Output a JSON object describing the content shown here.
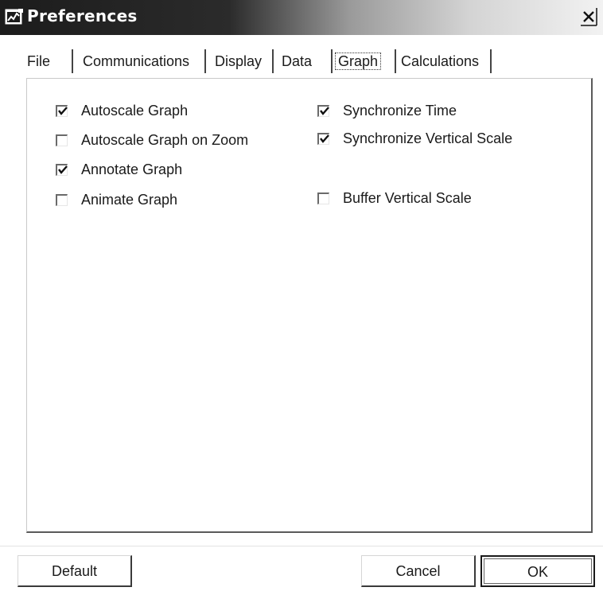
{
  "window": {
    "title": "Preferences",
    "close_glyph": "×",
    "title_icon": "chart-window-icon"
  },
  "tabs": [
    {
      "label": "File",
      "selected": false
    },
    {
      "label": "Communications",
      "selected": false
    },
    {
      "label": "Display",
      "selected": false
    },
    {
      "label": "Data",
      "selected": false
    },
    {
      "label": "Graph",
      "selected": true
    },
    {
      "label": "Calculations",
      "selected": false
    }
  ],
  "options_left": [
    {
      "label": "Autoscale Graph",
      "checked": true
    },
    {
      "label": "Autoscale Graph on Zoom",
      "checked": false
    },
    {
      "label": "Annotate Graph",
      "checked": true
    },
    {
      "label": "Animate Graph",
      "checked": false
    }
  ],
  "options_right": [
    {
      "label": "Synchronize Time",
      "checked": true
    },
    {
      "label": "Synchronize Vertical Scale",
      "checked": true
    },
    {
      "label": "Buffer Vertical Scale",
      "checked": false
    }
  ],
  "buttons": {
    "default_label": "Default",
    "cancel_label": "Cancel",
    "ok_label": "OK"
  }
}
